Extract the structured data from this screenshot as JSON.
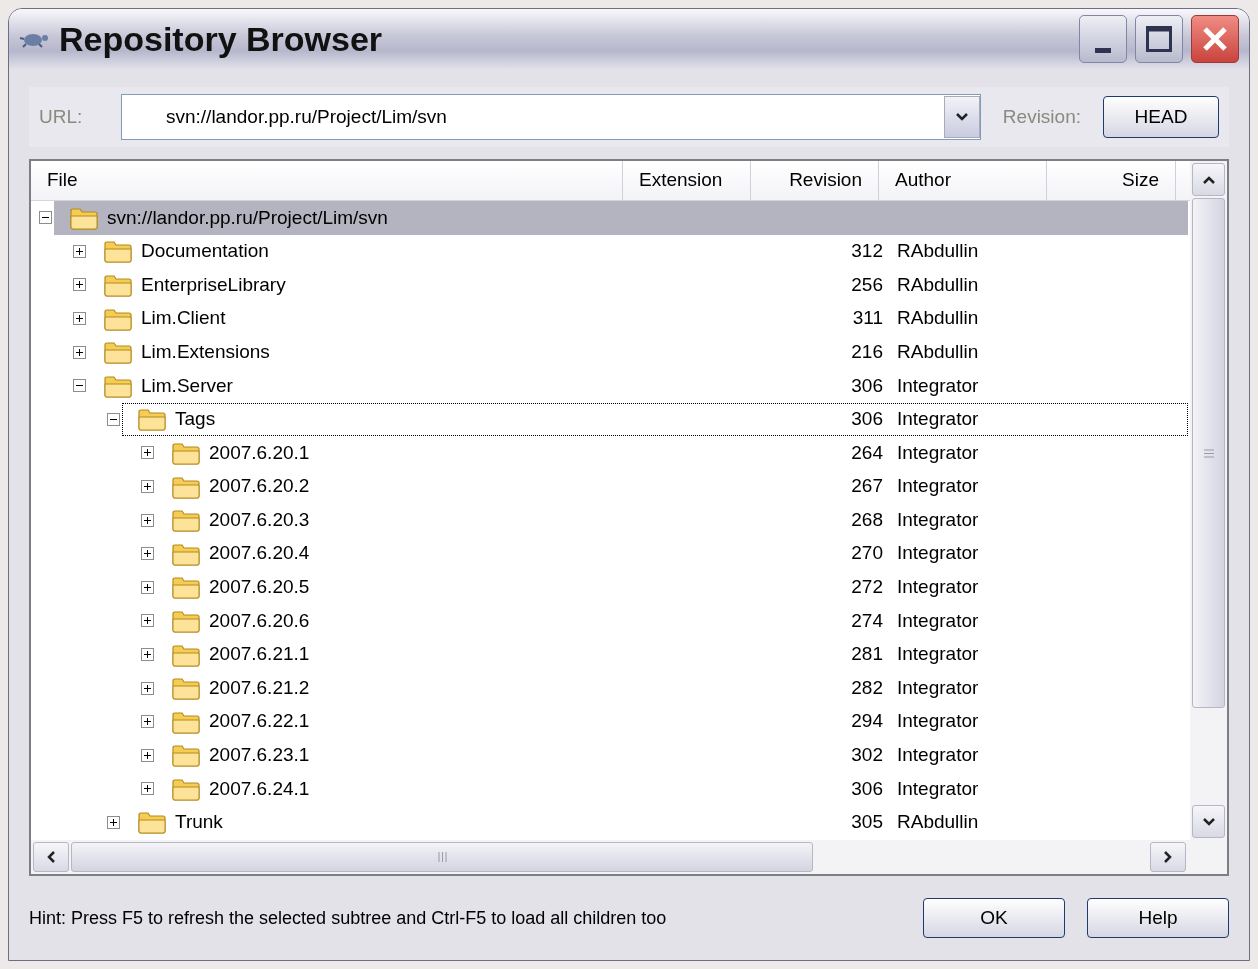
{
  "window": {
    "title": "Repository Browser"
  },
  "url": {
    "label": "URL:",
    "value": "svn://landor.pp.ru/Project/Lim/svn"
  },
  "revision": {
    "label": "Revision:",
    "button": "HEAD"
  },
  "columns": [
    "File",
    "Extension",
    "Revision",
    "Author",
    "Size"
  ],
  "tree": [
    {
      "name": "svn://landor.pp.ru/Project/Lim/svn",
      "selected": true,
      "focused": false,
      "expanded": true,
      "children": [
        {
          "name": "Documentation",
          "revision": "312",
          "author": "RAbdullin",
          "selected": false,
          "focused": false,
          "expanded": false
        },
        {
          "name": "EnterpriseLibrary",
          "revision": "256",
          "author": "RAbdullin",
          "selected": false,
          "focused": false,
          "expanded": false
        },
        {
          "name": "Lim.Client",
          "revision": "311",
          "author": "RAbdullin",
          "selected": false,
          "focused": false,
          "expanded": false
        },
        {
          "name": "Lim.Extensions",
          "revision": "216",
          "author": "RAbdullin",
          "selected": false,
          "focused": false,
          "expanded": false
        },
        {
          "name": "Lim.Server",
          "revision": "306",
          "author": "Integrator",
          "selected": false,
          "focused": false,
          "expanded": true,
          "children": [
            {
              "name": "Tags",
              "revision": "306",
              "author": "Integrator",
              "selected": false,
              "focused": true,
              "expanded": true,
              "children": [
                {
                  "name": "2007.6.20.1",
                  "revision": "264",
                  "author": "Integrator",
                  "selected": false,
                  "focused": false,
                  "expanded": false
                },
                {
                  "name": "2007.6.20.2",
                  "revision": "267",
                  "author": "Integrator",
                  "selected": false,
                  "focused": false,
                  "expanded": false
                },
                {
                  "name": "2007.6.20.3",
                  "revision": "268",
                  "author": "Integrator",
                  "selected": false,
                  "focused": false,
                  "expanded": false
                },
                {
                  "name": "2007.6.20.4",
                  "revision": "270",
                  "author": "Integrator",
                  "selected": false,
                  "focused": false,
                  "expanded": false
                },
                {
                  "name": "2007.6.20.5",
                  "revision": "272",
                  "author": "Integrator",
                  "selected": false,
                  "focused": false,
                  "expanded": false
                },
                {
                  "name": "2007.6.20.6",
                  "revision": "274",
                  "author": "Integrator",
                  "selected": false,
                  "focused": false,
                  "expanded": false
                },
                {
                  "name": "2007.6.21.1",
                  "revision": "281",
                  "author": "Integrator",
                  "selected": false,
                  "focused": false,
                  "expanded": false
                },
                {
                  "name": "2007.6.21.2",
                  "revision": "282",
                  "author": "Integrator",
                  "selected": false,
                  "focused": false,
                  "expanded": false
                },
                {
                  "name": "2007.6.22.1",
                  "revision": "294",
                  "author": "Integrator",
                  "selected": false,
                  "focused": false,
                  "expanded": false
                },
                {
                  "name": "2007.6.23.1",
                  "revision": "302",
                  "author": "Integrator",
                  "selected": false,
                  "focused": false,
                  "expanded": false
                },
                {
                  "name": "2007.6.24.1",
                  "revision": "306",
                  "author": "Integrator",
                  "selected": false,
                  "focused": false,
                  "expanded": false
                }
              ]
            },
            {
              "name": "Trunk",
              "revision": "305",
              "author": "RAbdullin",
              "selected": false,
              "focused": false,
              "expanded": false
            }
          ]
        }
      ]
    }
  ],
  "hint": "Hint: Press F5 to refresh the selected subtree and Ctrl-F5 to load all children too",
  "buttons": [
    "OK",
    "Help"
  ]
}
